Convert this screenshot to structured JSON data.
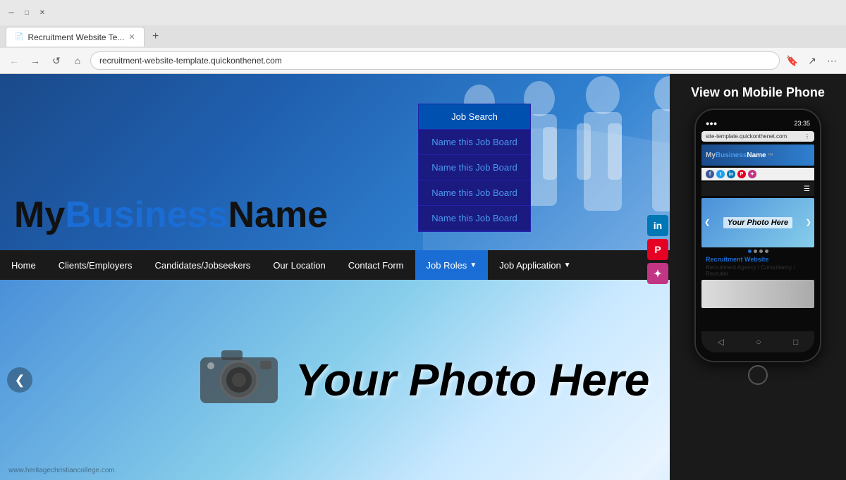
{
  "browser": {
    "title": "Recruitment Website Te...",
    "url_display": "recruitment-website-template.quickonthenet.com",
    "url_prefix": "recruitment-website-template.",
    "url_domain": "quickonthenet.com",
    "tab_label": "Recruitment Website Te...",
    "new_tab_label": "+",
    "nav_back": "←",
    "nav_forward": "→",
    "nav_refresh": "↺",
    "nav_home": "⌂"
  },
  "site": {
    "business_name_my": "My",
    "business_name_business": "Business",
    "business_name_name": "Name",
    "hero_text": "Your Photo Here",
    "watermark": "www.heritagechristiancollege.com"
  },
  "nav": {
    "items": [
      {
        "label": "Home",
        "active": false
      },
      {
        "label": "Clients/Employers",
        "active": false
      },
      {
        "label": "Candidates/Jobseekers",
        "active": false
      },
      {
        "label": "Our Location",
        "active": false
      },
      {
        "label": "Contact Form",
        "active": false
      },
      {
        "label": "Job Roles",
        "active": true,
        "has_dropdown": true
      },
      {
        "label": "Job Application",
        "active": false,
        "has_dropdown": true
      }
    ],
    "dropdown": {
      "items": [
        {
          "label": "Job Search",
          "style": "first"
        },
        {
          "label": "Name this Job Board",
          "style": "link"
        },
        {
          "label": "Name this Job Board",
          "style": "link"
        },
        {
          "label": "Name this Job Board",
          "style": "link"
        },
        {
          "label": "Name this Job Board",
          "style": "link"
        }
      ]
    }
  },
  "mobile_panel": {
    "title": "View on Mobile Phone",
    "status_time": "23:35",
    "browser_url": "site-template.quickonthenet.com",
    "phone_business_my": "My",
    "phone_business_business": "Business",
    "phone_business_name": "Name",
    "phone_hero_text": "Your Photo Here",
    "phone_site_link": "Recruitment Website",
    "phone_description": "Recruitment Agency / Consultancy / Recruiter"
  },
  "social_icons": {
    "linkedin": {
      "color": "#0077b5",
      "label": "in"
    },
    "pinterest": {
      "color": "#e60023",
      "label": "P"
    },
    "instagram": {
      "color": "#c13584",
      "label": "✦"
    }
  },
  "arrows": {
    "left": "❮",
    "right": "❯"
  }
}
